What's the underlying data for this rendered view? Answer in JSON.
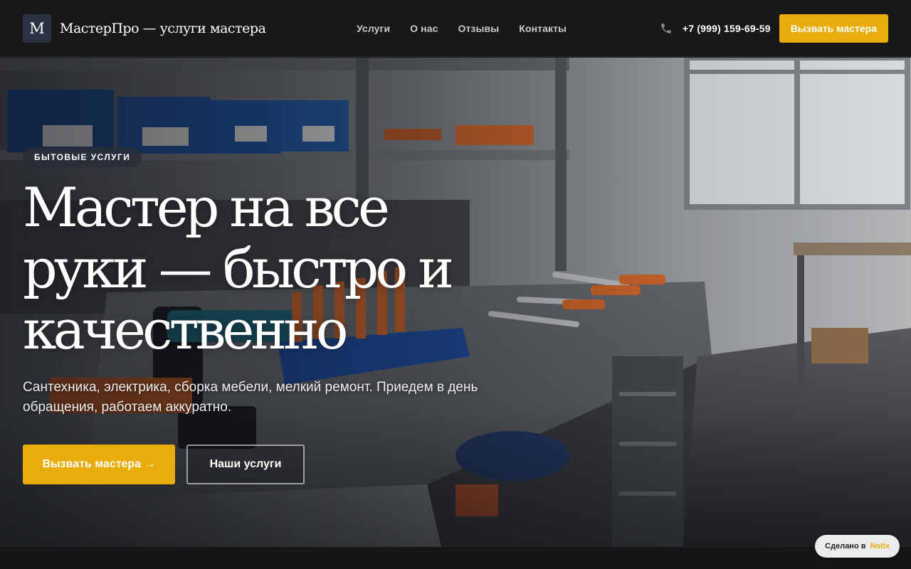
{
  "header": {
    "logo_letter": "M",
    "brand": "МастерПро — услуги мастера",
    "nav": [
      "Услуги",
      "О нас",
      "Отзывы",
      "Контакты"
    ],
    "phone": "+7 (999) 159-69-59",
    "cta": "Вызвать мастера"
  },
  "hero": {
    "badge": "БЫТОВЫЕ УСЛУГИ",
    "title": "Мастер на все руки — быстро и качественно",
    "subtitle": "Сантехника, электрика, сборка мебели, мелкий ремонт. Приедем в день обращения, работаем аккуратно.",
    "primary_button": "Вызвать мастера →",
    "secondary_button": "Наши услуги"
  },
  "made_with": {
    "label": "Сделано в",
    "brand": "Notix"
  },
  "icons": {
    "phone": "phone-icon",
    "logo": "logo-mark"
  },
  "colors": {
    "accent": "#e8ac0b",
    "header_bg": "#18181a",
    "logo_bg": "#2a3242"
  }
}
